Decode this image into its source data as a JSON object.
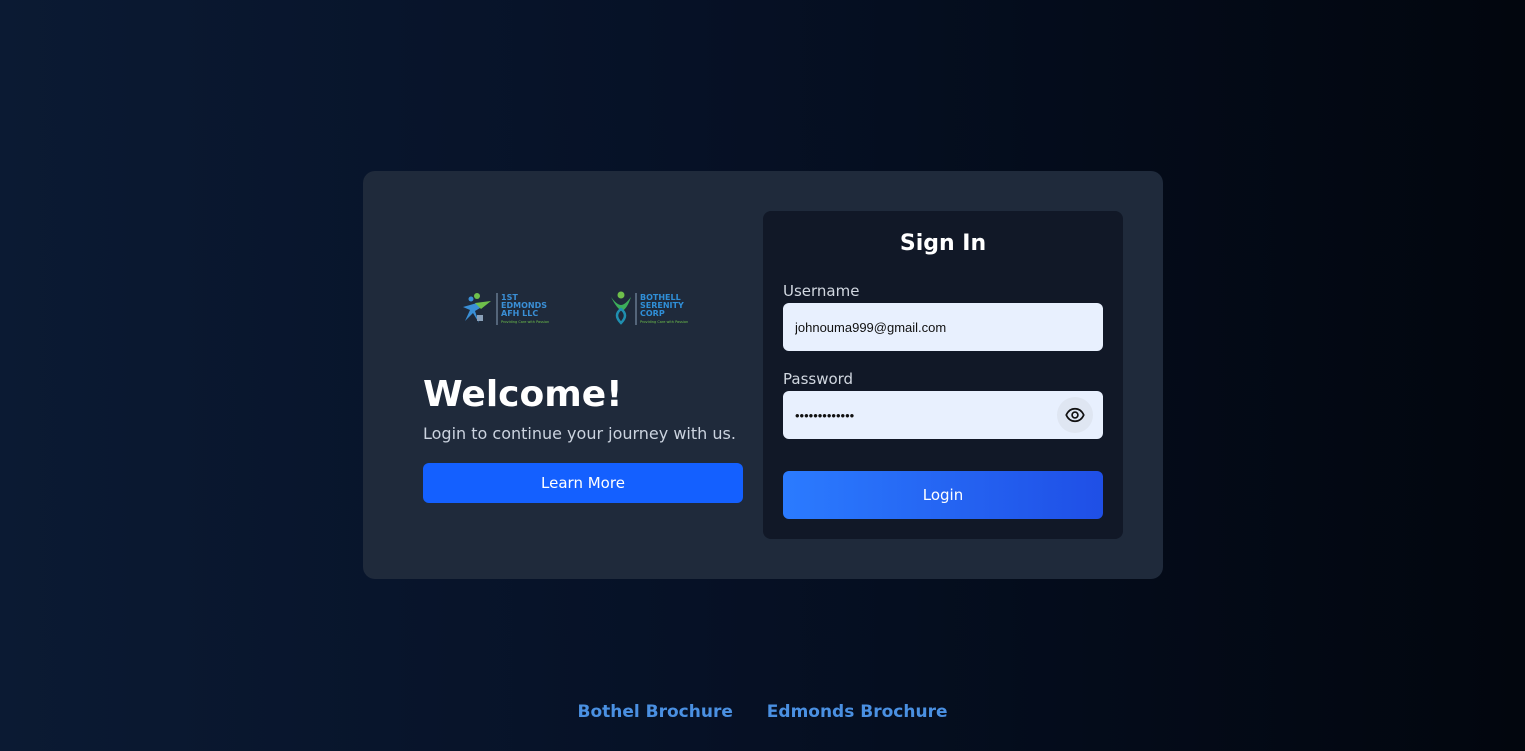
{
  "welcome": {
    "title": "Welcome!",
    "subtitle": "Login to continue your journey with us.",
    "learn_more_label": "Learn More",
    "logos": [
      {
        "name": "1ST EDMONDS AFH LLC",
        "line1": "1ST",
        "line2": "EDMONDS",
        "line3": "AFH LLC",
        "tagline": "Providing Care with Passion"
      },
      {
        "name": "BOTHELL SERENITY CORP",
        "line1": "BOTHELL",
        "line2": "SERENITY",
        "line3": "CORP",
        "tagline": "Providing Care with Passion"
      }
    ]
  },
  "signin": {
    "title": "Sign In",
    "username_label": "Username",
    "username_value": "johnouma999@gmail.com",
    "password_label": "Password",
    "password_value": "•••••••••••••",
    "show_password_icon": "eye-icon",
    "login_label": "Login"
  },
  "footer": {
    "links": [
      "Bothel Brochure",
      "Edmonds Brochure"
    ]
  },
  "colors": {
    "card": "#1f2a3b",
    "panel": "#111827",
    "primary": "#1460ff",
    "link": "#4a90e2",
    "input_bg": "#e8f0fe"
  }
}
